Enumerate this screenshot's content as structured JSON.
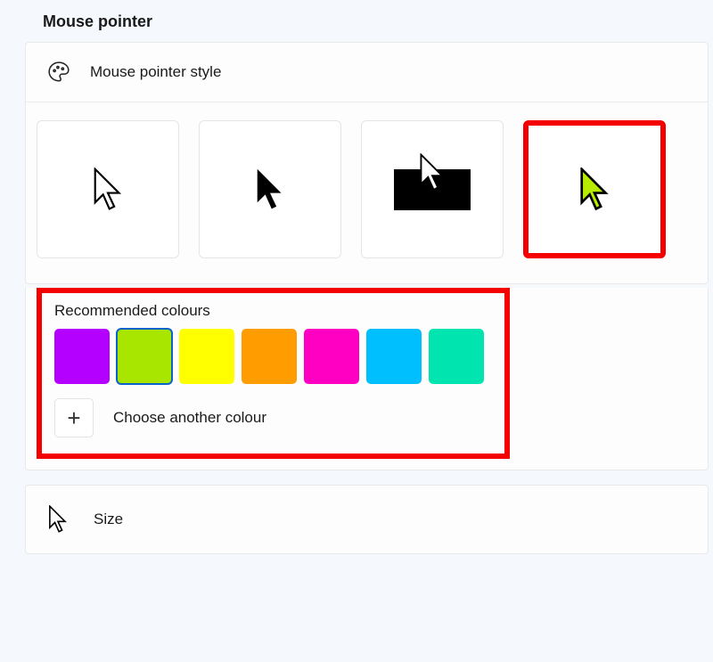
{
  "page_title": "Mouse pointer",
  "style_section": {
    "header": "Mouse pointer style",
    "options": [
      {
        "id": "white",
        "selected": false
      },
      {
        "id": "black",
        "selected": false
      },
      {
        "id": "inverted",
        "selected": false
      },
      {
        "id": "custom",
        "selected": true
      }
    ]
  },
  "colours_section": {
    "title": "Recommended colours",
    "swatches": [
      {
        "hex": "#b400ff",
        "selected": false
      },
      {
        "hex": "#a8e600",
        "selected": true
      },
      {
        "hex": "#ffff00",
        "selected": false
      },
      {
        "hex": "#ff9d00",
        "selected": false
      },
      {
        "hex": "#ff00c3",
        "selected": false
      },
      {
        "hex": "#00bfff",
        "selected": false
      },
      {
        "hex": "#00e5b0",
        "selected": false
      }
    ],
    "choose_another_label": "Choose another colour",
    "custom_cursor_color": "#b7eb00"
  },
  "size_section": {
    "label": "Size"
  }
}
